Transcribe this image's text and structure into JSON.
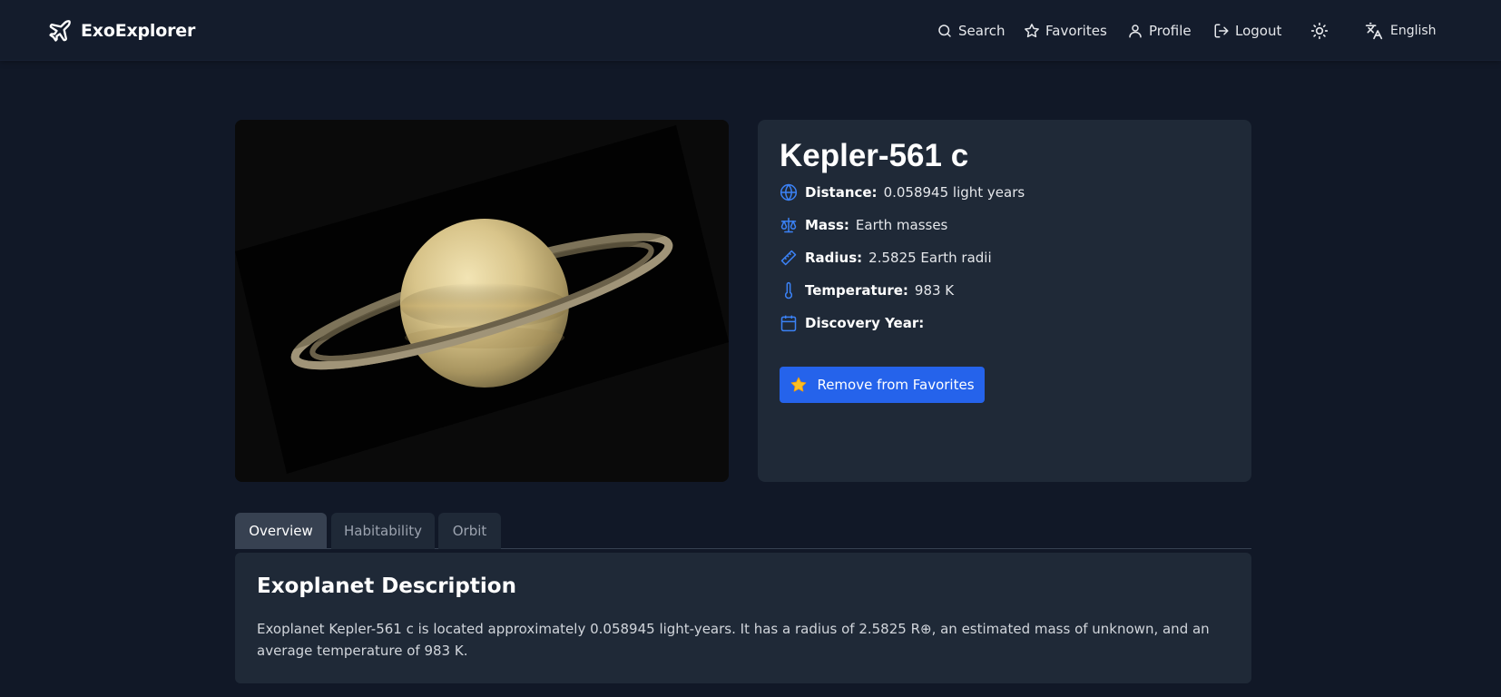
{
  "navbar": {
    "brand": "ExoExplorer",
    "brand_icon": "plane-icon",
    "links": {
      "search": "Search",
      "favorites": "Favorites",
      "profile": "Profile",
      "logout": "Logout"
    },
    "theme_icon": "sun-icon",
    "language": "English"
  },
  "planet": {
    "name": "Kepler-561 c",
    "image_alt": "Saturn-like ringed planet",
    "stats": {
      "distance": {
        "label": "Distance:",
        "value": "0.058945 light years",
        "icon": "globe-icon"
      },
      "mass": {
        "label": "Mass:",
        "value": "Earth masses",
        "icon": "scale-icon"
      },
      "radius": {
        "label": "Radius:",
        "value": "2.5825 Earth radii",
        "icon": "ruler-icon"
      },
      "temperature": {
        "label": "Temperature:",
        "value": "983 K",
        "icon": "thermometer-icon"
      },
      "discovery_year": {
        "label": "Discovery Year:",
        "value": "",
        "icon": "calendar-icon"
      }
    },
    "favorite_button": "Remove from Favorites"
  },
  "tabs": {
    "overview": "Overview",
    "habitability": "Habitability",
    "orbit": "Orbit",
    "active": "overview"
  },
  "description": {
    "title": "Exoplanet Description",
    "text": "Exoplanet Kepler-561 c is located approximately 0.058945 light-years. It has a radius of 2.5825 R⊕, an estimated mass of unknown, and an average temperature of 983 K."
  },
  "colors": {
    "background": "#111827",
    "navbar": "#141c2c",
    "card": "#1f2937",
    "accent": "#2563eb",
    "icon_blue": "#3b82f6"
  }
}
